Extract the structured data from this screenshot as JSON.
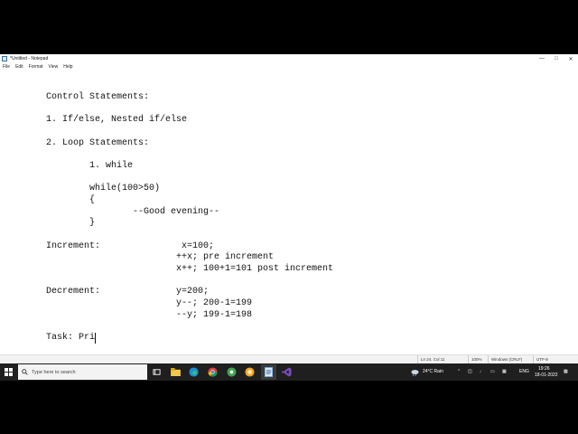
{
  "window": {
    "title": "*Untitled - Notepad"
  },
  "menu": [
    "File",
    "Edit",
    "Format",
    "View",
    "Help"
  ],
  "editor": {
    "lines": [
      "Control Statements:",
      "1. If/else, Nested if/else",
      "2. Loop Statements:",
      "        1. while",
      "        while(100>50)",
      "        {",
      "                --Good evening--",
      "        }",
      "Increment:               x=100;",
      "                        ++x; pre increment",
      "                        x++; 100+1=101 post increment",
      "Decrement:              y=200;",
      "                        y--; 200-1=199",
      "                        --y; 199-1=198",
      "Task: Pri"
    ]
  },
  "status": {
    "position": "Ln 24, Col 11",
    "zoom": "100%",
    "line_ending": "Windows (CRLF)",
    "encoding": "UTF-8"
  },
  "taskbar": {
    "search_placeholder": "Type here to search",
    "weather": "24°C  Rain",
    "language": "ENG",
    "time": "19:26",
    "date": "18-01-2022"
  },
  "colors": {
    "taskbar_bg": "#1f1f1f",
    "edge_blue": "#1a8fd6",
    "chrome": "#e9b400",
    "vs_purple": "#7b4bbf"
  }
}
